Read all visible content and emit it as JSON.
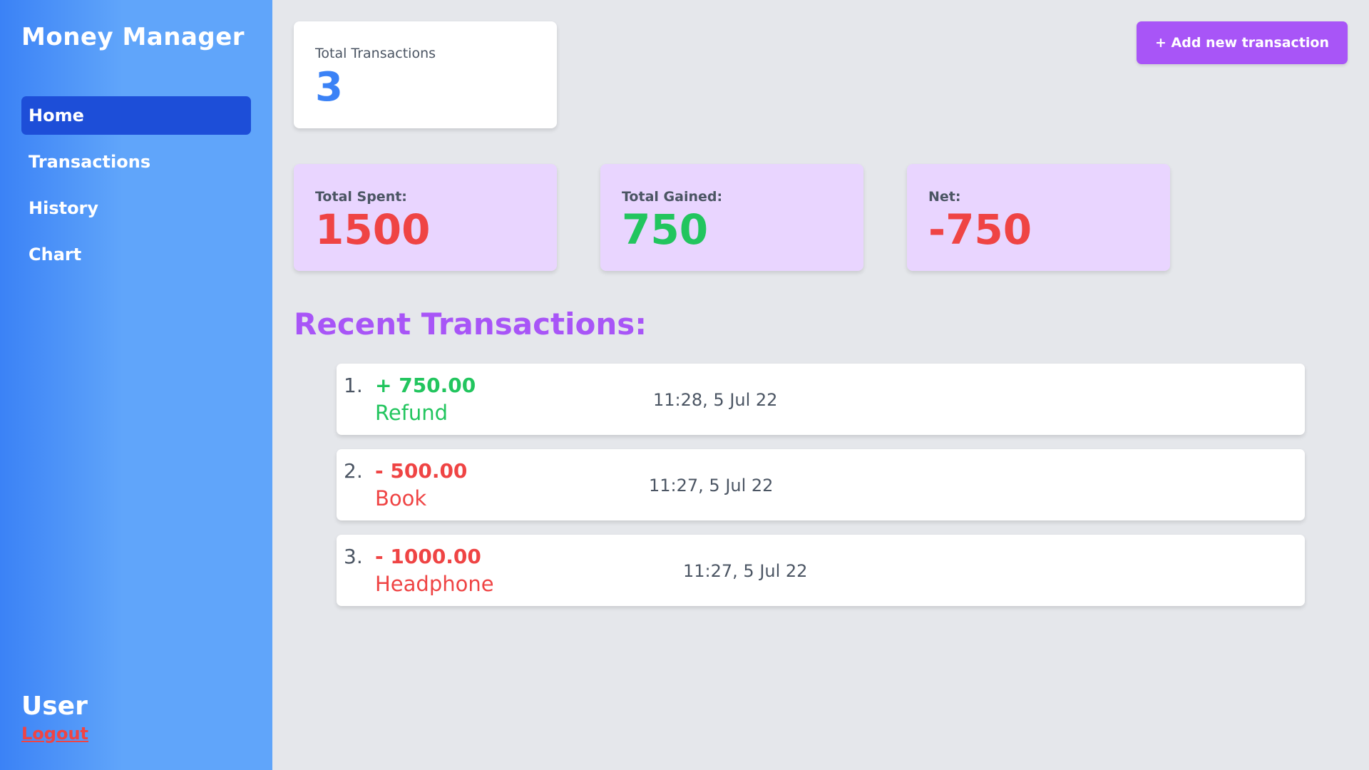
{
  "sidebar": {
    "brand": "Money Manager",
    "items": [
      {
        "label": "Home",
        "active": true
      },
      {
        "label": "Transactions",
        "active": false
      },
      {
        "label": "History",
        "active": false
      },
      {
        "label": "Chart",
        "active": false
      }
    ],
    "user": "User",
    "logout": "Logout"
  },
  "summary": {
    "total_label": "Total Transactions",
    "total_value": "3",
    "spent_label": "Total Spent:",
    "spent_value": "1500",
    "gained_label": "Total Gained:",
    "gained_value": "750",
    "net_label": "Net:",
    "net_value": "-750"
  },
  "toolbar": {
    "add_label": "+ Add new transaction"
  },
  "recent": {
    "title": "Recent Transactions:",
    "items": [
      {
        "num": "1.",
        "amount": "+ 750.00",
        "desc": "Refund",
        "time": "11:28, 5 Jul 22",
        "type": "gain"
      },
      {
        "num": "2.",
        "amount": "- 500.00",
        "desc": "Book",
        "time": "11:27, 5 Jul 22",
        "type": "spend"
      },
      {
        "num": "3.",
        "amount": "- 1000.00",
        "desc": "Headphone",
        "time": "11:27, 5 Jul 22",
        "type": "spend"
      }
    ]
  },
  "colors": {
    "accent": "#a855f7",
    "primary": "#3b82f6",
    "active_nav": "#1d4ed8",
    "spent": "#ef4444",
    "gained": "#22c55e",
    "stat_card": "#e9d5ff"
  }
}
